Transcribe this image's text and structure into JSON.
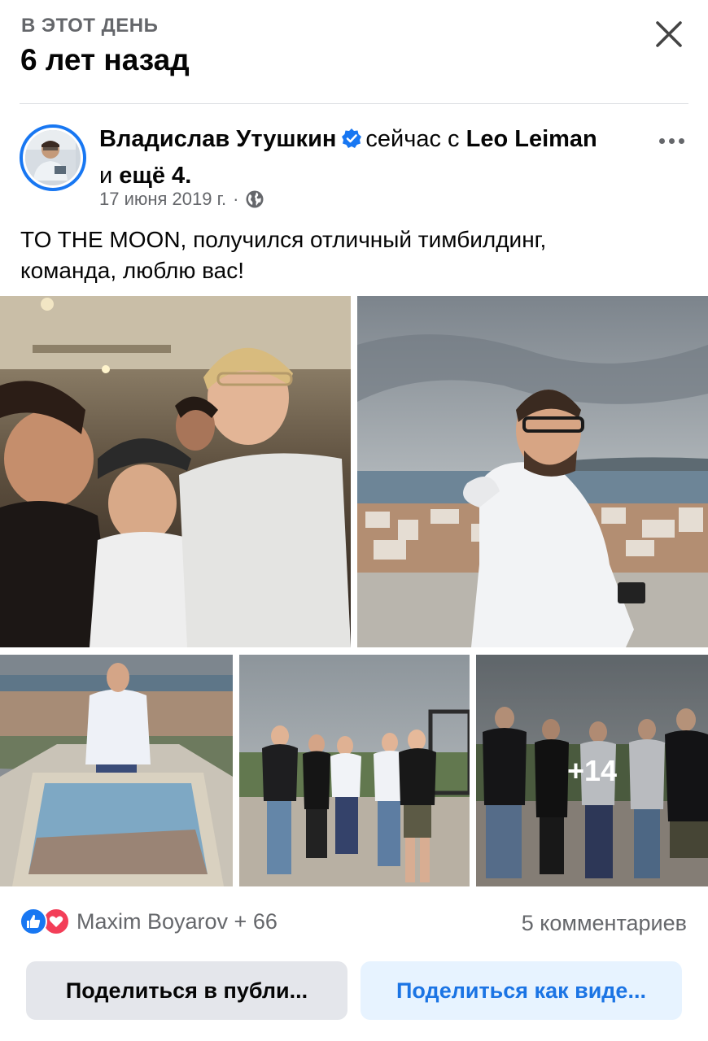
{
  "header": {
    "kicker": "В ЭТОТ ДЕНЬ",
    "title": "6 лет назад",
    "close_icon": "close-icon"
  },
  "post": {
    "author": "Владислав Утушкин",
    "with_prefix": "сейчас с",
    "tagged_name": "Leo Leiman",
    "and_text": "и",
    "more_people": "ещё 4",
    "period": ".",
    "date": "17 июня 2019 г.",
    "separator": "·",
    "privacy_icon": "globe-icon",
    "text_line1": "TO THE MOON, получился отличный тимбилдинг,",
    "text_line2": "команда, люблю вас!",
    "extra_photos": "+14"
  },
  "footer": {
    "reactors": "Maxim Boyarov + 66",
    "comments": "5 комментариев",
    "share_public": "Поделиться в публи...",
    "share_video": "Поделиться как виде..."
  },
  "colors": {
    "accent": "#1877f2",
    "secondary_text": "#65676b",
    "love": "#f33e58",
    "video_button_bg": "#e7f3ff",
    "video_button_text": "#1b74e4"
  }
}
